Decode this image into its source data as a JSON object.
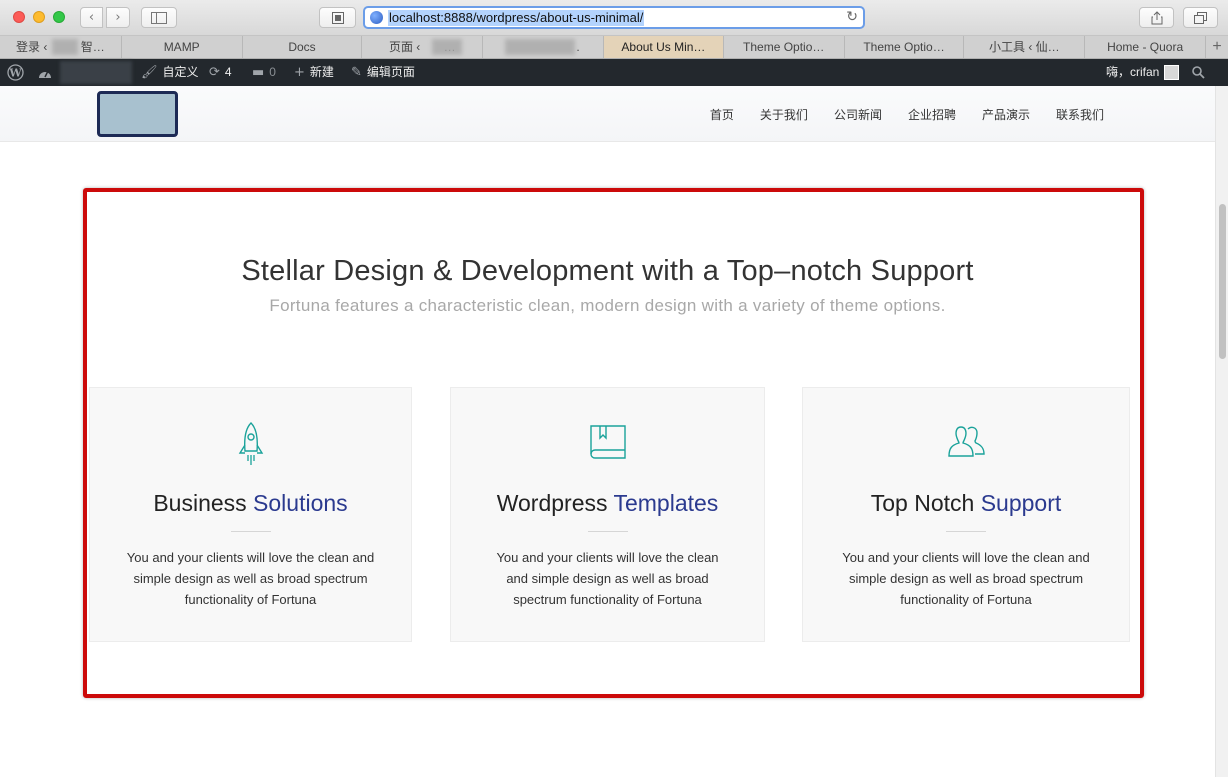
{
  "browser": {
    "url": "localhost:8888/wordpress/about-us-minimal/",
    "tabs": [
      {
        "label": "登录 ‹ ",
        "label2": "智…",
        "active": false
      },
      {
        "label": "MAMP",
        "active": false
      },
      {
        "label": "Docs",
        "active": false
      },
      {
        "label": "页面 ‹",
        "label2": "…",
        "active": false
      },
      {
        "label": ".",
        "active": false
      },
      {
        "label": "About Us Min…",
        "active": true
      },
      {
        "label": "Theme Optio…",
        "active": false
      },
      {
        "label": "Theme Optio…",
        "active": false
      },
      {
        "label": "小工具 ‹ 仙…",
        "active": false
      },
      {
        "label": "Home - Quora",
        "active": false
      }
    ],
    "new_tab_label": "+"
  },
  "adminbar": {
    "customize": "自定义",
    "updates_count": "4",
    "comments_count": "0",
    "new": "新建",
    "edit_page": "编辑页面",
    "greeting": "嗨，crifan"
  },
  "nav": {
    "items": [
      "首页",
      "关于我们",
      "公司新闻",
      "企业招聘",
      "产品演示",
      "联系我们"
    ]
  },
  "hero": {
    "title": "Stellar Design & Development with a Top–notch Support",
    "subtitle": "Fortuna features a characteristic clean, modern design with a variety of theme options."
  },
  "features": [
    {
      "icon": "rocket-icon",
      "title_plain": "Business ",
      "title_accent": "Solutions",
      "line1": "You and your clients will love the clean and",
      "line2": "simple design as well as broad spectrum",
      "line3": "functionality of Fortuna"
    },
    {
      "icon": "book-icon",
      "title_plain": "Wordpress ",
      "title_accent": "Templates",
      "line1": "You and your clients will love the clean",
      "line2": "and simple design as well as broad",
      "line3": "spectrum functionality of Fortuna"
    },
    {
      "icon": "users-icon",
      "title_plain": "Top Notch ",
      "title_accent": "Support",
      "line1": "You and your clients will love the clean and",
      "line2": "simple design as well as broad spectrum",
      "line3": "functionality of Fortuna"
    }
  ],
  "colors": {
    "accent": "#2b3a8f",
    "icon_teal": "#1aa29a",
    "highlight_border": "#cc0a0a",
    "adminbar_bg": "#23282d"
  }
}
